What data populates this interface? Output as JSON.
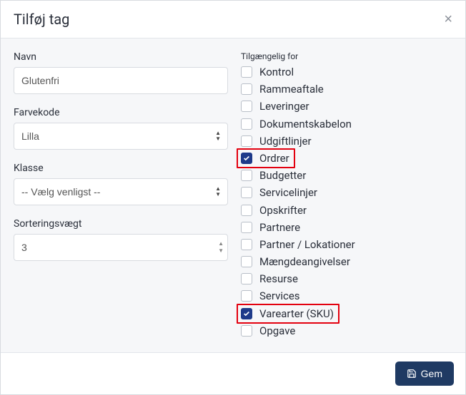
{
  "header": {
    "title": "Tilføj tag",
    "close_label": "×"
  },
  "form": {
    "name_label": "Navn",
    "name_value": "Glutenfri",
    "colorcode_label": "Farvekode",
    "colorcode_value": "Lilla",
    "class_label": "Klasse",
    "class_value": "-- Vælg venligst --",
    "sortweight_label": "Sorteringsvægt",
    "sortweight_value": "3"
  },
  "available": {
    "label": "Tilgængelig for",
    "items": [
      {
        "label": "Kontrol",
        "checked": false
      },
      {
        "label": "Rammeaftale",
        "checked": false
      },
      {
        "label": "Leveringer",
        "checked": false
      },
      {
        "label": "Dokumentskabelon",
        "checked": false
      },
      {
        "label": "Udgiftlinjer",
        "checked": false
      },
      {
        "label": "Ordrer",
        "checked": true,
        "highlight": true
      },
      {
        "label": "Budgetter",
        "checked": false
      },
      {
        "label": "Servicelinjer",
        "checked": false
      },
      {
        "label": "Opskrifter",
        "checked": false
      },
      {
        "label": "Partnere",
        "checked": false
      },
      {
        "label": "Partner / Lokationer",
        "checked": false
      },
      {
        "label": "Mængdeangivelser",
        "checked": false
      },
      {
        "label": "Resurse",
        "checked": false
      },
      {
        "label": "Services",
        "checked": false
      },
      {
        "label": "Varearter (SKU)",
        "checked": true,
        "highlight": true
      },
      {
        "label": "Opgave",
        "checked": false
      }
    ]
  },
  "footer": {
    "save_label": "Gem"
  }
}
